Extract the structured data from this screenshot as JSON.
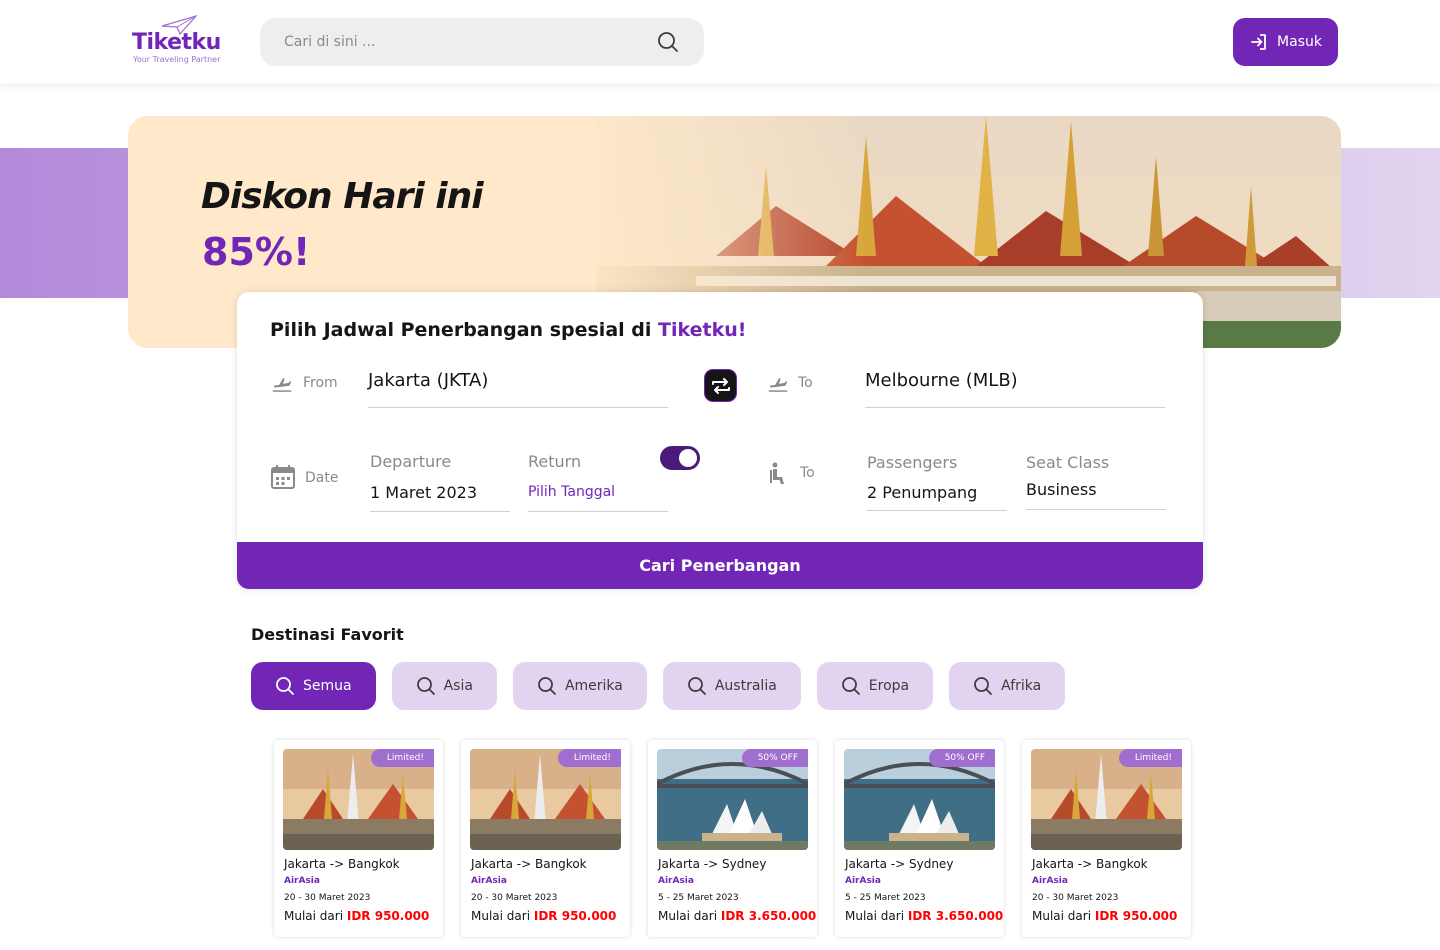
{
  "header": {
    "logo_text": "Tiketku",
    "logo_tagline": "Your Traveling Partner",
    "search_placeholder": "Cari di sini ...",
    "login_label": "Masuk"
  },
  "banner": {
    "title": "Diskon Hari ini",
    "discount": "85%!"
  },
  "flight_form": {
    "title_prefix": "Pilih Jadwal Penerbangan spesial di",
    "title_brand": "Tiketku!",
    "from_label": "From",
    "from_value": "Jakarta (JKTA)",
    "to_label": "To",
    "to_value": "Melbourne (MLB)",
    "date_label": "Date",
    "departure_label": "Departure",
    "departure_value": "1 Maret 2023",
    "return_label": "Return",
    "return_value": "Pilih Tanggal",
    "return_toggle_on": true,
    "passenger_row_label": "To",
    "passengers_label": "Passengers",
    "passengers_value": "2 Penumpang",
    "seat_class_label": "Seat Class",
    "seat_class_value": "Business",
    "search_button": "Cari Penerbangan"
  },
  "favorites": {
    "title": "Destinasi Favorit",
    "filters": [
      "Semua",
      "Asia",
      "Amerika",
      "Australia",
      "Eropa",
      "Afrika"
    ],
    "active_filter": "Semua",
    "cards": [
      {
        "route": "Jakarta -> Bangkok",
        "airline": "AirAsia",
        "dates": "20 - 30 Maret 2023",
        "price_prefix": "Mulai dari",
        "price": "IDR 950.000",
        "badge": "Limited!",
        "image": "bangkok-temple"
      },
      {
        "route": "Jakarta -> Bangkok",
        "airline": "AirAsia",
        "dates": "20 - 30 Maret 2023",
        "price_prefix": "Mulai dari",
        "price": "IDR 950.000",
        "badge": "Limited!",
        "image": "bangkok-temple"
      },
      {
        "route": "Jakarta -> Sydney",
        "airline": "AirAsia",
        "dates": "5 - 25 Maret 2023",
        "price_prefix": "Mulai dari",
        "price": "IDR 3.650.000",
        "badge": "50% OFF",
        "image": "sydney-opera-house"
      },
      {
        "route": "Jakarta -> Sydney",
        "airline": "AirAsia",
        "dates": "5 - 25 Maret 2023",
        "price_prefix": "Mulai dari",
        "price": "IDR 3.650.000",
        "badge": "50% OFF",
        "image": "sydney-opera-house"
      },
      {
        "route": "Jakarta -> Bangkok",
        "airline": "AirAsia",
        "dates": "20 - 30 Maret 2023",
        "price_prefix": "Mulai dari",
        "price": "IDR 950.000",
        "badge": "Limited!",
        "image": "bangkok-temple"
      }
    ]
  },
  "colors": {
    "brand": "#7126B5",
    "brand_light": "#E2D4F0",
    "accent_badge": "#A06ECE",
    "price": "#FF0000",
    "banner_bg": "#FFE9CA"
  }
}
